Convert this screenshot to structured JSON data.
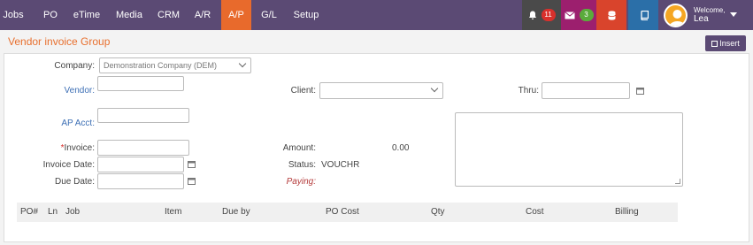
{
  "nav": {
    "items": [
      "Jobs",
      "PO",
      "eTime",
      "Media",
      "CRM",
      "A/R",
      "A/P",
      "G/L",
      "Setup"
    ],
    "active": "A/P",
    "notifications_count": "11",
    "messages_count": "3",
    "welcome_label": "Welcome,",
    "user_name": "Lea",
    "colors": {
      "bar": "#5b4a74",
      "active": "#e86a2c",
      "bell_bg": "#4a4a4a",
      "mail_bg": "#9c1f6e",
      "db_bg": "#d9442c",
      "book_bg": "#2b6fa8",
      "badge_red": "#d9302c",
      "badge_green": "#5aab3b"
    }
  },
  "page": {
    "title": "Vendor invoice Group",
    "insert_label": "Insert"
  },
  "form": {
    "company_label": "Company:",
    "company_value": "Demonstration Company (DEM)",
    "vendor_label": "Vendor:",
    "vendor_value": "",
    "client_label": "Client:",
    "client_value": "",
    "thru_label": "Thru:",
    "thru_value": "",
    "ap_acct_label": "AP Acct:",
    "ap_acct_value": "",
    "invoice_required_mark": "*",
    "invoice_label": "Invoice:",
    "invoice_value": "",
    "amount_label": "Amount:",
    "amount_value": "0.00",
    "invoice_date_label": "Invoice Date:",
    "invoice_date_value": "",
    "status_label": "Status:",
    "status_value": "VOUCHR",
    "due_date_label": "Due Date:",
    "due_date_value": "",
    "paying_label": "Paying:",
    "notes_value": ""
  },
  "table": {
    "columns": [
      "PO#",
      "Ln",
      "Job",
      "Item",
      "Due by",
      "PO Cost",
      "Qty",
      "Cost",
      "Billing"
    ],
    "rows": []
  }
}
